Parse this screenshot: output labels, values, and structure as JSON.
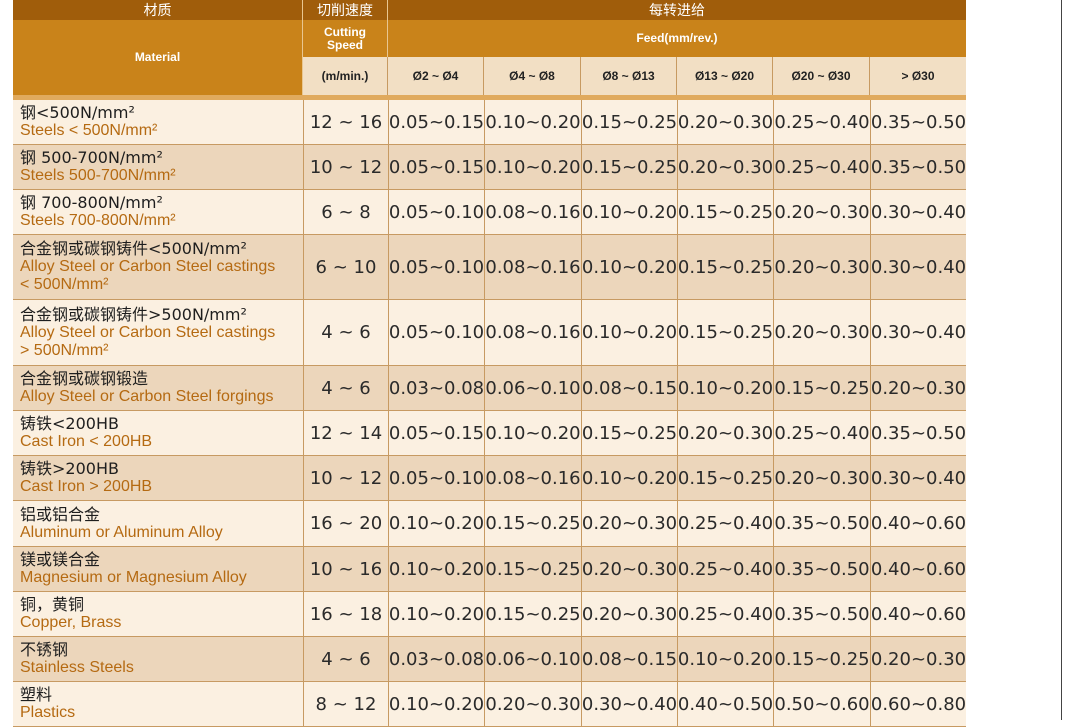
{
  "header": {
    "material_cn": "材质",
    "material_en": "Material",
    "speed_cn": "切削速度",
    "speed_en": "Cutting Speed",
    "speed_unit": "(m/min.)",
    "feed_cn": "每转进给",
    "feed_en": "Feed(mm/rev.)",
    "diameters": [
      "Ø2 ~ Ø4",
      "Ø4 ~ Ø8",
      "Ø8 ~ Ø13",
      "Ø13 ~ Ø20",
      "Ø20 ~ Ø30",
      "> Ø30"
    ]
  },
  "rows": [
    {
      "cn": "钢<500N/mm²",
      "en": "Steels < 500N/mm²",
      "en2": "",
      "speed": "12 ~ 16",
      "feeds": [
        "0.05~0.15",
        "0.10~0.20",
        "0.15~0.25",
        "0.20~0.30",
        "0.25~0.40",
        "0.35~0.50"
      ]
    },
    {
      "cn": "钢 500-700N/mm²",
      "en": "Steels 500-700N/mm²",
      "en2": "",
      "speed": "10 ~ 12",
      "feeds": [
        "0.05~0.15",
        "0.10~0.20",
        "0.15~0.25",
        "0.20~0.30",
        "0.25~0.40",
        "0.35~0.50"
      ]
    },
    {
      "cn": "钢 700-800N/mm²",
      "en": "Steels 700-800N/mm²",
      "en2": "",
      "speed": "6 ~ 8",
      "feeds": [
        "0.05~0.10",
        "0.08~0.16",
        "0.10~0.20",
        "0.15~0.25",
        "0.20~0.30",
        "0.30~0.40"
      ]
    },
    {
      "cn": "合金钢或碳钢铸件<500N/mm²",
      "en": "Alloy Steel or Carbon Steel castings",
      "en2": "< 500N/mm²",
      "speed": "6 ~ 10",
      "feeds": [
        "0.05~0.10",
        "0.08~0.16",
        "0.10~0.20",
        "0.15~0.25",
        "0.20~0.30",
        "0.30~0.40"
      ]
    },
    {
      "cn": "合金钢或碳钢铸件>500N/mm²",
      "en": "Alloy Steel or Carbon Steel castings",
      "en2": "> 500N/mm²",
      "speed": "4 ~ 6",
      "feeds": [
        "0.05~0.10",
        "0.08~0.16",
        "0.10~0.20",
        "0.15~0.25",
        "0.20~0.30",
        "0.30~0.40"
      ]
    },
    {
      "cn": "合金钢或碳钢锻造",
      "en": "Alloy Steel or Carbon Steel forgings",
      "en2": "",
      "speed": "4 ~ 6",
      "feeds": [
        "0.03~0.08",
        "0.06~0.10",
        "0.08~0.15",
        "0.10~0.20",
        "0.15~0.25",
        "0.20~0.30"
      ]
    },
    {
      "cn": "铸铁<200HB",
      "en": "Cast Iron < 200HB",
      "en2": "",
      "speed": "12 ~ 14",
      "feeds": [
        "0.05~0.15",
        "0.10~0.20",
        "0.15~0.25",
        "0.20~0.30",
        "0.25~0.40",
        "0.35~0.50"
      ]
    },
    {
      "cn": "铸铁>200HB",
      "en": "Cast Iron > 200HB",
      "en2": "",
      "speed": "10 ~ 12",
      "feeds": [
        "0.05~0.10",
        "0.08~0.16",
        "0.10~0.20",
        "0.15~0.25",
        "0.20~0.30",
        "0.30~0.40"
      ]
    },
    {
      "cn": "铝或铝合金",
      "en": "Aluminum or Aluminum Alloy",
      "en2": "",
      "speed": "16 ~ 20",
      "feeds": [
        "0.10~0.20",
        "0.15~0.25",
        "0.20~0.30",
        "0.25~0.40",
        "0.35~0.50",
        "0.40~0.60"
      ]
    },
    {
      "cn": "镁或镁合金",
      "en": "Magnesium or Magnesium Alloy",
      "en2": "",
      "speed": "10 ~ 16",
      "feeds": [
        "0.10~0.20",
        "0.15~0.25",
        "0.20~0.30",
        "0.25~0.40",
        "0.35~0.50",
        "0.40~0.60"
      ]
    },
    {
      "cn": "铜，黄铜",
      "en": "Copper, Brass",
      "en2": "",
      "speed": "16 ~ 18",
      "feeds": [
        "0.10~0.20",
        "0.15~0.25",
        "0.20~0.30",
        "0.25~0.40",
        "0.35~0.50",
        "0.40~0.60"
      ]
    },
    {
      "cn": "不锈钢",
      "en": "Stainless Steels",
      "en2": "",
      "speed": "4 ~ 6",
      "feeds": [
        "0.03~0.08",
        "0.06~0.10",
        "0.08~0.15",
        "0.10~0.20",
        "0.15~0.25",
        "0.20~0.30"
      ]
    },
    {
      "cn": "塑料",
      "en": "Plastics",
      "en2": "",
      "speed": "8 ~ 12",
      "feeds": [
        "0.10~0.20",
        "0.20~0.30",
        "0.30~0.40",
        "0.40~0.50",
        "0.50~0.60",
        "0.60~0.80"
      ]
    }
  ]
}
